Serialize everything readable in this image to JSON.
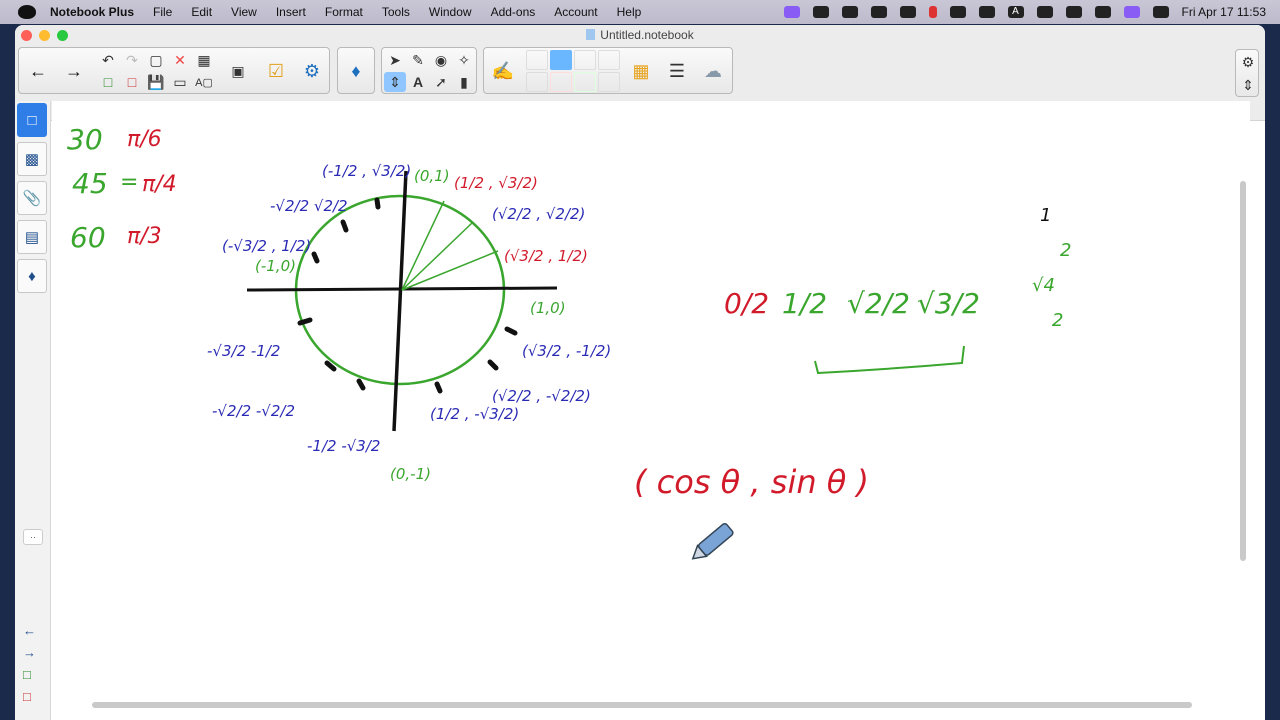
{
  "menubar": {
    "app_name": "Notebook Plus",
    "items": [
      "File",
      "Edit",
      "View",
      "Insert",
      "Format",
      "Tools",
      "Window",
      "Add-ons",
      "Account",
      "Help"
    ],
    "clock": "Fri Apr 17  11:53",
    "status_icons": [
      "screen-record-icon",
      "tray-icon",
      "cloud-icon",
      "cast-icon",
      "sparkle-icon",
      "battery-red-icon",
      "bluetooth-icon",
      "volume-icon",
      "text-input-icon",
      "battery-icon",
      "wifi-icon",
      "user-icon",
      "siri-icon",
      "control-center-icon"
    ],
    "input_letter": "A"
  },
  "window": {
    "title": "Untitled.notebook"
  },
  "toolbar": {
    "groups": [
      "navigation",
      "edit",
      "view",
      "activities",
      "addons",
      "select",
      "pens",
      "lines",
      "shapes",
      "settings"
    ],
    "selected_tool": "text-pen"
  },
  "sidebar": {
    "tabs": [
      "page-sorter",
      "gallery",
      "attachments",
      "properties",
      "addons"
    ],
    "active": "page-sorter",
    "collapse_label": "··"
  },
  "canvas": {
    "left_notes": [
      {
        "deg": "30",
        "rad": "π/6"
      },
      {
        "deg": "45",
        "eq": "=",
        "rad": "π/4"
      },
      {
        "deg": "60",
        "rad": "π/3"
      }
    ],
    "circle_labels": {
      "top_left_coord": "(-1/2 , √3/2)",
      "top": "(0,1)",
      "q1a": "(1/2 , √3/2)",
      "q1b": "(√2/2 , √2/2)",
      "q1c": "(√3/2 , 1/2)",
      "right": "(1,0)",
      "left": "(-1,0)",
      "q2a": "-√2/2 √2/2",
      "q2b": "(-√3/2 , 1/2)",
      "q3a": "-√3/2  -1/2",
      "q3b": "-√2/2  -√2/2",
      "q3c": "-1/2  -√3/2",
      "bottom": "(0,-1)",
      "q4a": "(1/2 , -√3/2)",
      "q4b": "(√2/2 , -√2/2)",
      "q4c": "(√3/2 , -1/2)"
    },
    "fractions": [
      "0/2",
      "1/2",
      "√2/2",
      "√3/2"
    ],
    "side_note": [
      "1",
      "2",
      "√4",
      "2"
    ],
    "formula": "( cos θ ,  sin θ )",
    "colors": {
      "green": "#3aa62e",
      "blue": "#2a2ab5",
      "red": "#d11b2b",
      "black": "#111111"
    }
  }
}
